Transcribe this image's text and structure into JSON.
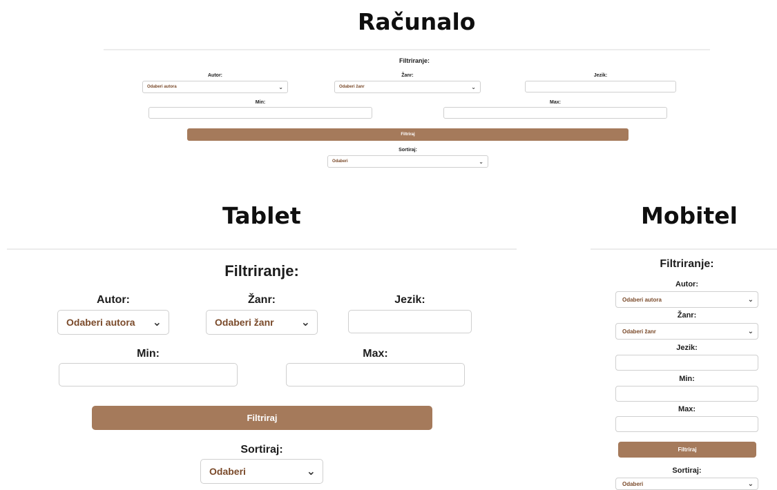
{
  "desktop": {
    "heading": "Računalo",
    "filter_title": "Filtriranje:",
    "author_label": "Autor:",
    "author_value": "Odaberi autora",
    "genre_label": "Žanr:",
    "genre_value": "Odaberi žanr",
    "language_label": "Jezik:",
    "min_label": "Min:",
    "max_label": "Max:",
    "filter_button": "Filtriraj",
    "sort_label": "Sortiraj:",
    "sort_value": "Odaberi"
  },
  "tablet": {
    "heading": "Tablet",
    "filter_title": "Filtriranje:",
    "author_label": "Autor:",
    "author_value": "Odaberi autora",
    "genre_label": "Žanr:",
    "genre_value": "Odaberi žanr",
    "language_label": "Jezik:",
    "min_label": "Min:",
    "max_label": "Max:",
    "filter_button": "Filtriraj",
    "sort_label": "Sortiraj:",
    "sort_value": "Odaberi"
  },
  "mobile": {
    "heading": "Mobitel",
    "filter_title": "Filtriranje:",
    "author_label": "Autor:",
    "author_value": "Odaberi autora",
    "genre_label": "Žanr:",
    "genre_value": "Odaberi žanr",
    "language_label": "Jezik:",
    "min_label": "Min:",
    "max_label": "Max:",
    "filter_button": "Filtriraj",
    "sort_label": "Sortiraj:",
    "sort_value": "Odaberi"
  },
  "icons": {
    "dropdown": "chevron-down-icon"
  },
  "colors": {
    "button": "#a57a5b",
    "select_text": "#7a4a2a",
    "divider": "#ececec"
  }
}
